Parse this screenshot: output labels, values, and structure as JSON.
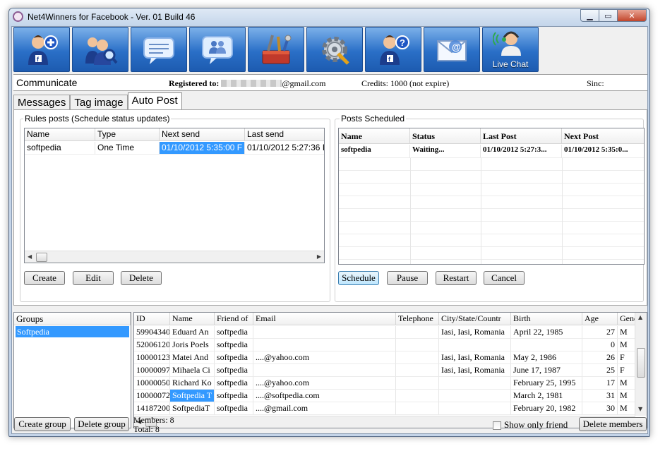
{
  "window": {
    "title": "Net4Winners for Facebook - Ver. 01 Build 46"
  },
  "toolbar": {
    "buttons": [
      {
        "icon": "add-user-icon",
        "label": ""
      },
      {
        "icon": "find-user-icon",
        "label": ""
      },
      {
        "icon": "message-bubble-icon",
        "label": ""
      },
      {
        "icon": "group-chat-icon",
        "label": ""
      },
      {
        "icon": "toolbox-icon",
        "label": ""
      },
      {
        "icon": "settings-gear-icon",
        "label": ""
      },
      {
        "icon": "help-user-icon",
        "label": ""
      },
      {
        "icon": "email-icon",
        "label": ""
      },
      {
        "icon": "live-chat-icon",
        "label": "Live Chat"
      }
    ]
  },
  "status": {
    "section": "Communicate",
    "registered_label": "Registered to:",
    "registered_email_suffix": "@gmail.com",
    "credits": "Credits: 1000 (not expire)",
    "sinc": "Sinc:"
  },
  "tabs": [
    "Messages",
    "Tag image",
    "Auto Post"
  ],
  "active_tab": "Auto Post",
  "rules": {
    "title": "Rules posts (Schedule status updates)",
    "columns": [
      "Name",
      "Type",
      "Next send",
      "Last send"
    ],
    "rows": [
      [
        "softpedia",
        "One Time",
        "01/10/2012 5:35:00 F",
        "01/10/2012 5:27:36 I"
      ]
    ],
    "buttons": {
      "create": "Create",
      "edit": "Edit",
      "delete": "Delete"
    }
  },
  "scheduled": {
    "title": "Posts Scheduled",
    "columns": [
      "Name",
      "Status",
      "Last Post",
      "Next Post"
    ],
    "rows": [
      [
        "softpedia",
        "Waiting...",
        "01/10/2012 5:27:3...",
        "01/10/2012 5:35:0..."
      ]
    ],
    "buttons": {
      "schedule": "Schedule",
      "pause": "Pause",
      "restart": "Restart",
      "cancel": "Cancel"
    }
  },
  "groups": {
    "header": "Groups",
    "items": [
      "Softpedia"
    ],
    "create_button": "Create group",
    "delete_button": "Delete group"
  },
  "members": {
    "columns": [
      "ID",
      "Name",
      "Friend of",
      "Email",
      "Telephone",
      "City/State/Countr",
      "Birth",
      "Age",
      "Gend"
    ],
    "rows": [
      [
        "59904340",
        "Eduard An",
        "softpedia",
        "",
        "",
        "Iasi, Iasi, Romania",
        "April 22, 1985",
        "27",
        "M"
      ],
      [
        "52006120",
        "Joris Poels",
        "softpedia",
        "",
        "",
        "",
        "",
        "0",
        "M"
      ],
      [
        "10000123",
        "Matei And",
        "softpedia",
        "....@yahoo.com",
        "",
        "Iasi, Iasi, Romania",
        "May 2, 1986",
        "26",
        "F"
      ],
      [
        "10000097",
        "Mihaela Ci",
        "softpedia",
        "",
        "",
        "Iasi, Iasi, Romania",
        "June 17, 1987",
        "25",
        "F"
      ],
      [
        "10000050",
        "Richard Ko",
        "softpedia",
        "....@yahoo.com",
        "",
        "",
        "February 25, 1995",
        "17",
        "M"
      ],
      [
        "10000072",
        "Softpedia T",
        "softpedia",
        "....@softpedia.com",
        "",
        "",
        "March 2, 1981",
        "31",
        "M"
      ],
      [
        "14187200",
        "SoftpediaT",
        "softpedia",
        "....@gmail.com",
        "",
        "",
        "February 20, 1982",
        "30",
        "M"
      ]
    ],
    "members_count": "Members: 8",
    "total_count": "Total: 8",
    "show_only_friend": "Show only friend",
    "delete_members": "Delete members"
  }
}
